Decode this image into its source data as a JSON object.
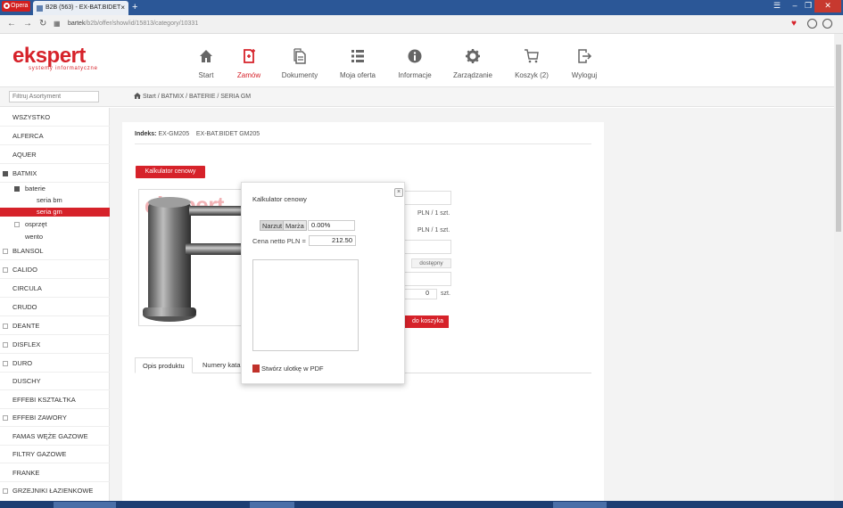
{
  "browser": {
    "menu_label": "Opera",
    "tab_title": "B2B (563) - EX-BAT.BIDET",
    "tab_close": "×",
    "new_tab": "+",
    "url_host": "bartek",
    "url_path": "/b2b/offer/show/id/15813/category/10331",
    "window_minimize": "–",
    "window_maximize": "❐",
    "window_close": "✕"
  },
  "logo": {
    "brand": "ekspert",
    "tagline": "systemy informatyczne"
  },
  "nav": [
    {
      "label": "Start",
      "icon": "home-icon"
    },
    {
      "label": "Zamów",
      "icon": "order-icon",
      "active": true
    },
    {
      "label": "Dokumenty",
      "icon": "documents-icon"
    },
    {
      "label": "Moja oferta",
      "icon": "list-icon"
    },
    {
      "label": "Informacje",
      "icon": "info-icon"
    },
    {
      "label": "Zarządzanie",
      "icon": "gear-icon"
    },
    {
      "label": "Koszyk (2)",
      "icon": "cart-icon"
    },
    {
      "label": "Wyloguj",
      "icon": "logout-icon"
    }
  ],
  "filter": {
    "placeholder": "Filtruj Asortyment"
  },
  "breadcrumb": "Start / BATMIX / BATERIE / SERIA GM",
  "sidebar": {
    "items": [
      {
        "label": "WSZYSTKO",
        "toggle": ""
      },
      {
        "label": "ALFERCA",
        "toggle": ""
      },
      {
        "label": "AQUER",
        "toggle": ""
      },
      {
        "label": "BATMIX",
        "toggle": "−"
      },
      {
        "label": "baterie",
        "toggle": "−"
      },
      {
        "label": "seria bm",
        "toggle": ""
      },
      {
        "label": "seria gm",
        "toggle": "",
        "active": true
      },
      {
        "label": "osprzęt",
        "toggle": "+"
      },
      {
        "label": "wento",
        "toggle": ""
      },
      {
        "label": "BLANSOL",
        "toggle": "+"
      },
      {
        "label": "CALIDO",
        "toggle": "+"
      },
      {
        "label": "CIRCULA",
        "toggle": ""
      },
      {
        "label": "CRUDO",
        "toggle": ""
      },
      {
        "label": "DEANTE",
        "toggle": "+"
      },
      {
        "label": "DISFLEX",
        "toggle": "+"
      },
      {
        "label": "DURO",
        "toggle": "+"
      },
      {
        "label": "DUSCHY",
        "toggle": ""
      },
      {
        "label": "EFFEBI KSZTAŁTKA",
        "toggle": ""
      },
      {
        "label": "EFFEBI ZAWORY",
        "toggle": "+"
      },
      {
        "label": "FAMAS WĘŻE GAZOWE",
        "toggle": ""
      },
      {
        "label": "FILTRY GAZOWE",
        "toggle": ""
      },
      {
        "label": "FRANKE",
        "toggle": ""
      },
      {
        "label": "GRZEJNIKI ŁAZIENKOWE",
        "toggle": "+"
      }
    ]
  },
  "product": {
    "index_label": "Indeks:",
    "index_value": "EX-GM205",
    "name": "EX-BAT.BIDET GM205",
    "calc_button": "Kalkulator cenowy",
    "watermark": "ekspert",
    "price_unit_1": "PLN / 1 szt.",
    "price_unit_2": "PLN / 1 szt.",
    "stock": "dostępny",
    "qty": "0",
    "qty_unit": "szt.",
    "add_to_cart": "do koszyka",
    "tab_description": "Opis produktu",
    "tab_catalog": "Numery kata"
  },
  "modal": {
    "title": "Kalkulator cenowy",
    "close": "×",
    "btn_markup": "Narzut",
    "btn_margin": "Marża",
    "percent_value": "0.00%",
    "net_label": "Cena netto PLN  =",
    "net_value": "212.50",
    "pdf_link": "Stwórz ulotkę w PDF"
  },
  "colors": {
    "brand_red": "#d6222a",
    "tabbar_blue": "#2b5797"
  }
}
